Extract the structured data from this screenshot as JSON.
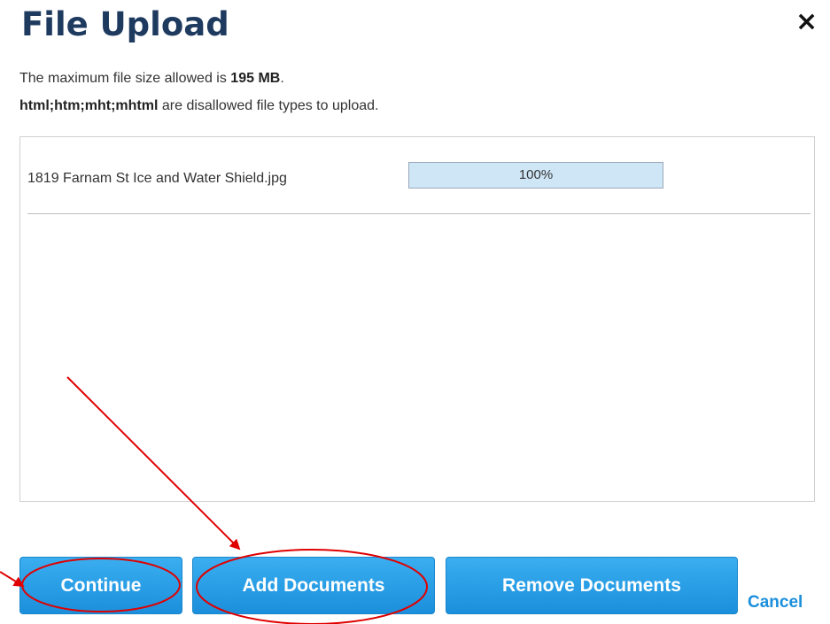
{
  "dialog": {
    "title": "File Upload",
    "close_glyph": "×",
    "max_size_prefix": "The maximum file size allowed is ",
    "max_size_value": "195 MB",
    "max_size_suffix": ".",
    "disallowed_types": "html;htm;mht;mhtml",
    "disallowed_suffix": " are disallowed file types to upload."
  },
  "files": [
    {
      "name": "1819 Farnam St Ice and Water Shield.jpg",
      "progress_label": "100%",
      "progress_fraction": 1.0
    }
  ],
  "buttons": {
    "continue_label": "Continue",
    "add_label": "Add Documents",
    "remove_label": "Remove Documents",
    "cancel_label": "Cancel"
  },
  "colors": {
    "title": "#1e3a5f",
    "button": "#1b8fdb",
    "annotation": "#e00000"
  },
  "icons": {
    "close": "close-icon"
  }
}
